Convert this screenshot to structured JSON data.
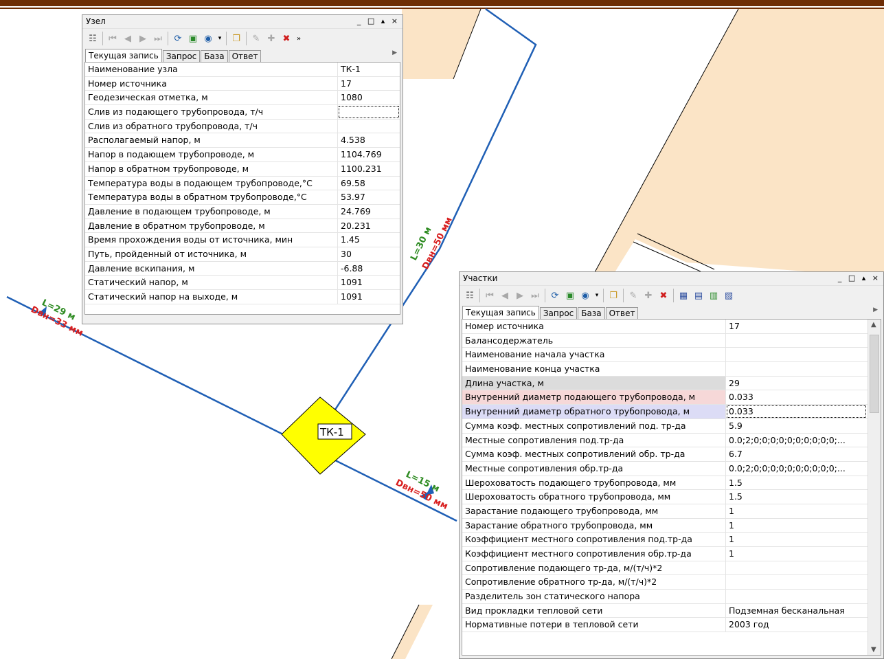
{
  "colors": {
    "header_bar": "#6e2e06",
    "parcel_fill": "#fbe4c6",
    "pipe": "#1f5fb5",
    "node_fill": "#ffff00",
    "length_label": "#2e8b22",
    "diameter_label": "#d81e1e"
  },
  "map": {
    "node_label": "ТК-1",
    "labels": [
      {
        "length": "L=29 м",
        "diameter": "Dвн=33 мм"
      },
      {
        "length": "L=30 м",
        "diameter": "Dвн=50 мм"
      },
      {
        "length": "L=15 м",
        "diameter": "Dвн=50 мм"
      }
    ]
  },
  "node_window": {
    "title": "Узел",
    "tabs": [
      "Текущая запись",
      "Запрос",
      "База",
      "Ответ"
    ],
    "rows": [
      {
        "name": "Наименование узла",
        "value": "ТК-1"
      },
      {
        "name": "Номер источника",
        "value": "17"
      },
      {
        "name": "Геодезическая отметка, м",
        "value": "1080"
      },
      {
        "name": "Слив из подающего трубопровода, т/ч",
        "value": ""
      },
      {
        "name": "Слив из обратного трубопровода, т/ч",
        "value": ""
      },
      {
        "name": "Располагаемый напор, м",
        "value": "4.538"
      },
      {
        "name": "Напор в подающем трубопроводе, м",
        "value": "1104.769"
      },
      {
        "name": "Напор в обратном трубопроводе, м",
        "value": "1100.231"
      },
      {
        "name": "Температура воды в подающем трубопроводе,°С",
        "value": "69.58"
      },
      {
        "name": "Температура воды в обратном трубопроводе,°С",
        "value": "53.97"
      },
      {
        "name": "Давление в подающем трубопроводе, м",
        "value": "24.769"
      },
      {
        "name": "Давление в обратном трубопроводе, м",
        "value": "20.231"
      },
      {
        "name": "Время прохождения воды от источника, мин",
        "value": "1.45"
      },
      {
        "name": "Путь, пройденный от источника, м",
        "value": "30"
      },
      {
        "name": "Давление вскипания, м",
        "value": "-6.88"
      },
      {
        "name": "Статический напор, м",
        "value": "1091"
      },
      {
        "name": "Статический напор на выходе, м",
        "value": "1091"
      }
    ]
  },
  "section_window": {
    "title": "Участки",
    "tabs": [
      "Текущая запись",
      "Запрос",
      "База",
      "Ответ"
    ],
    "rows": [
      {
        "name": "Номер источника",
        "value": "17"
      },
      {
        "name": "Балансодержатель",
        "value": ""
      },
      {
        "name": "Наименование начала участка",
        "value": ""
      },
      {
        "name": "Наименование конца участка",
        "value": ""
      },
      {
        "name": "Длина участка, м",
        "value": "29"
      },
      {
        "name": "Внутренний диаметр подающего трубопровода, м",
        "value": "0.033"
      },
      {
        "name": "Внутренний диаметр обратного трубопровода, м",
        "value": "0.033"
      },
      {
        "name": "Сумма коэф. местных сопротивлений под. тр-да",
        "value": "5.9"
      },
      {
        "name": "Местные сопротивления под.тр-да",
        "value": "0.0;2;0;0;0;0;0;0;0;0;0;0;..."
      },
      {
        "name": "Сумма коэф. местных сопротивлений обр. тр-да",
        "value": "6.7"
      },
      {
        "name": "Местные сопротивления обр.тр-да",
        "value": "0.0;2;0;0;0;0;0;0;0;0;0;0;..."
      },
      {
        "name": "Шероховатость подающего трубопровода, мм",
        "value": "1.5"
      },
      {
        "name": "Шероховатость обратного трубопровода, мм",
        "value": "1.5"
      },
      {
        "name": "Зарастание подающего трубопровода, мм",
        "value": "1"
      },
      {
        "name": "Зарастание обратного трубопровода, мм",
        "value": "1"
      },
      {
        "name": "Коэффициент местного сопротивления под.тр-да",
        "value": "1"
      },
      {
        "name": "Коэффициент местного сопротивления обр.тр-да",
        "value": "1"
      },
      {
        "name": "Сопротивление подающего тр-да, м/(т/ч)*2",
        "value": ""
      },
      {
        "name": "Сопротивление обратного тр-да, м/(т/ч)*2",
        "value": ""
      },
      {
        "name": "Разделитель зон статического напора",
        "value": ""
      },
      {
        "name": "Вид прокладки тепловой сети",
        "value": "Подземная бесканальная"
      },
      {
        "name": "Нормативные потери в тепловой сети",
        "value": "2003 год"
      }
    ]
  }
}
